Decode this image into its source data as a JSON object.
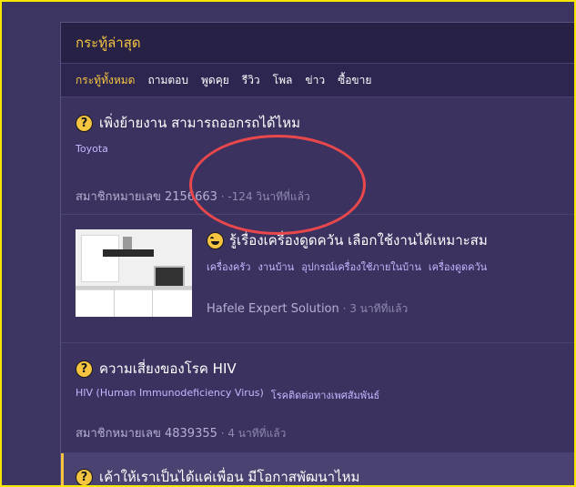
{
  "panel": {
    "title": "กระทู้ล่าสุด"
  },
  "tabs": [
    {
      "label": "กระทู้ทั้งหมด",
      "active": true
    },
    {
      "label": "ถามตอบ",
      "active": false
    },
    {
      "label": "พูดคุย",
      "active": false
    },
    {
      "label": "รีวิว",
      "active": false
    },
    {
      "label": "โพล",
      "active": false
    },
    {
      "label": "ข่าว",
      "active": false
    },
    {
      "label": "ซื้อขาย",
      "active": false
    }
  ],
  "topics": [
    {
      "icon": "question-icon",
      "title": "เพิ่งย้ายงาน สามารถออกรถได้ไหม",
      "tags": [
        "Toyota"
      ],
      "author": "สมาชิกหมายเลข 2156663",
      "time": "-124 วินาทีที่แล้ว"
    },
    {
      "icon": "smile-icon",
      "title": "รู้เรื่องเครื่องดูดควัน เลือกใช้งานได้เหมาะสม",
      "tags": [
        "เครื่องครัว",
        "งานบ้าน",
        "อุปกรณ์เครื่องใช้ภายในบ้าน",
        "เครื่องดูดควัน"
      ],
      "author": "Hafele Expert Solution",
      "time": "3 นาทีที่แล้ว"
    },
    {
      "icon": "question-icon",
      "title": "ความเสี่ยงของโรค HIV",
      "tags": [
        "HIV (Human Immunodeficiency Virus)",
        "โรคติดต่อทางเพศสัมพันธ์"
      ],
      "author": "สมาชิกหมายเลข 4839355",
      "time": "4 นาทีที่แล้ว"
    },
    {
      "icon": "question-icon",
      "title": "เค้าให้เราเป็นได้แค่เพื่อน มีโอกาสพัฒนาไหม"
    }
  ],
  "separator": " · ",
  "question_glyph": "?",
  "colors": {
    "accent": "#f5c542",
    "tag": "#c7b6ff",
    "annotation": "#e8474b",
    "highlight_border": "#f7e600"
  }
}
